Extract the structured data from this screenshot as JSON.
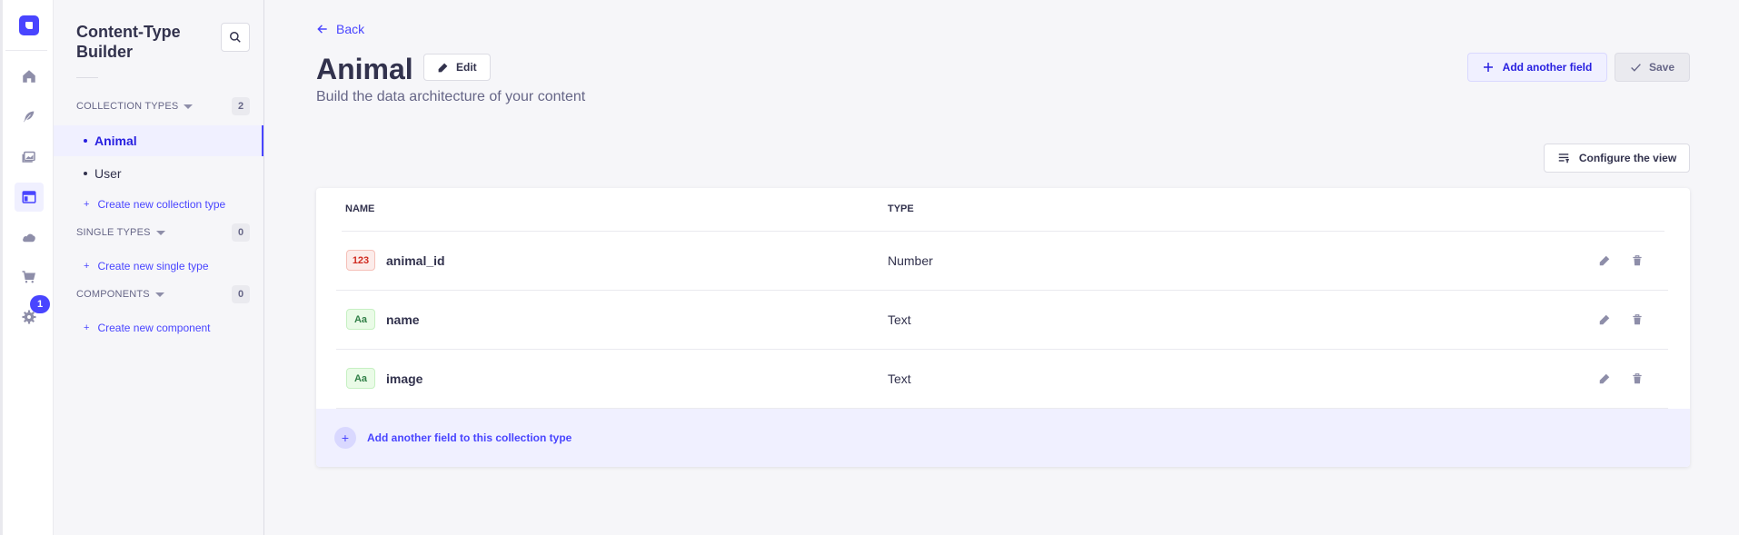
{
  "rail": {
    "badge_count": "1",
    "items": [
      "home-icon",
      "feather-icon",
      "media-icon",
      "layout-icon",
      "cloud-icon",
      "cart-icon",
      "settings-icon"
    ]
  },
  "sidebar": {
    "title": "Content-Type Builder",
    "collection_types": {
      "label": "Collection types",
      "count": "2",
      "items": [
        "Animal",
        "User"
      ],
      "create": "Create new collection type"
    },
    "single_types": {
      "label": "Single types",
      "count": "0",
      "create": "Create new single type"
    },
    "components": {
      "label": "Components",
      "count": "0",
      "create": "Create new component"
    }
  },
  "header": {
    "back": "Back",
    "title": "Animal",
    "edit": "Edit",
    "subtitle": "Build the data architecture of your content",
    "add_field": "Add another field",
    "save": "Save",
    "configure": "Configure the view"
  },
  "table": {
    "columns": [
      "Name",
      "Type"
    ],
    "rows": [
      {
        "badge": "123",
        "name": "animal_id",
        "type": "Number"
      },
      {
        "badge": "Aa",
        "name": "name",
        "type": "Text"
      },
      {
        "badge": "Aa",
        "name": "image",
        "type": "Text"
      }
    ],
    "add_row": "Add another field to this collection type"
  },
  "colors": {
    "primary": "#4945ff",
    "primary_light": "#f0f0ff"
  }
}
